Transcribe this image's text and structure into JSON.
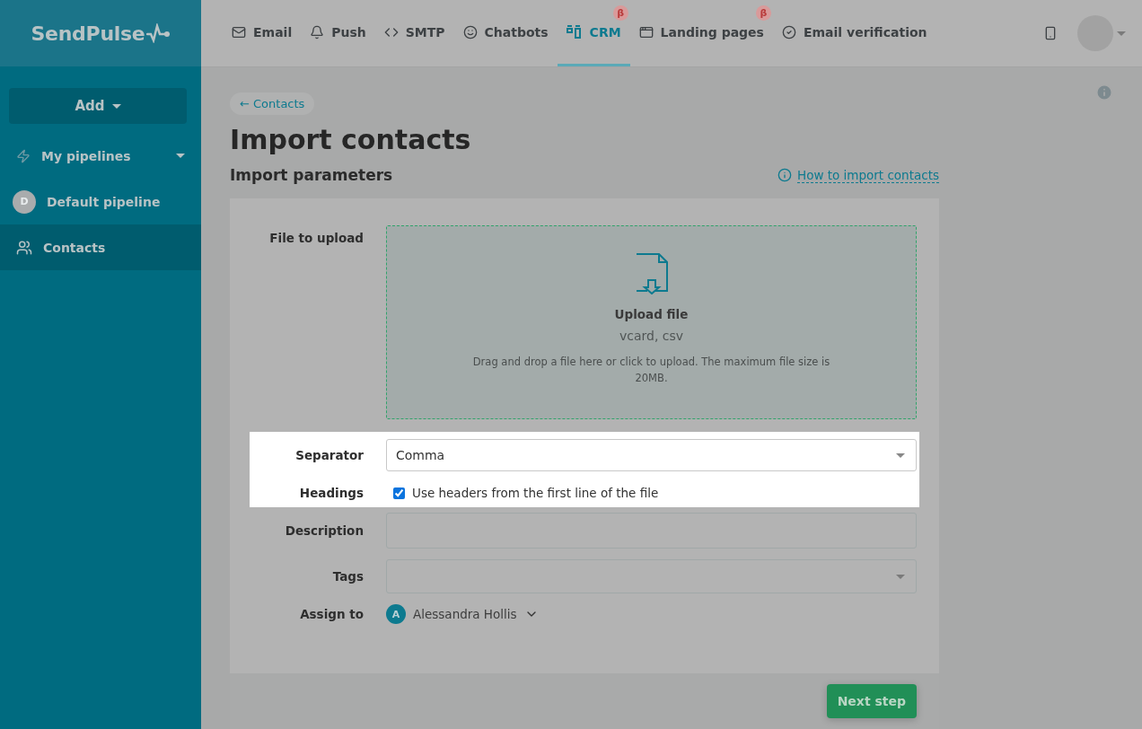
{
  "logo": "SendPulse",
  "nav": [
    {
      "label": "Email",
      "selected": false
    },
    {
      "label": "Push",
      "selected": false
    },
    {
      "label": "SMTP",
      "selected": false
    },
    {
      "label": "Chatbots",
      "selected": false
    },
    {
      "label": "CRM",
      "selected": true,
      "badge": "β"
    },
    {
      "label": "Landing pages",
      "selected": false,
      "badge": "β"
    },
    {
      "label": "Email verification",
      "selected": false
    }
  ],
  "sidebar": {
    "add_button": "Add",
    "items": [
      {
        "kind": "group",
        "label": "My pipelines",
        "selected": false
      },
      {
        "kind": "pipeline",
        "label": "Default pipeline",
        "initial": "D",
        "selected": false
      },
      {
        "kind": "contacts",
        "label": "Contacts",
        "selected": true
      }
    ]
  },
  "back_link": "← Contacts",
  "title": "Import contacts",
  "section_title": "Import parameters",
  "help_link": "How to import contacts",
  "form": {
    "rows": [
      {
        "kind": "upload",
        "label": "File to upload",
        "highlighted": false,
        "title": "Upload file",
        "formats": "vcard, csv",
        "hint": "Drag and drop a file here or click to upload. The maximum file size is 20MB."
      },
      {
        "kind": "select",
        "label": "Separator",
        "highlighted": true,
        "value": "Comma"
      },
      {
        "kind": "checkbox",
        "label": "Headings",
        "highlighted": true,
        "text": "Use headers from the first line of the file",
        "checked": true
      },
      {
        "kind": "input",
        "label": "Description",
        "highlighted": false
      },
      {
        "kind": "select",
        "label": "Tags",
        "highlighted": false
      },
      {
        "kind": "user",
        "label": "Assign to",
        "highlighted": false,
        "initial": "A",
        "value": "Alessandra Hollis"
      }
    ]
  },
  "next_button": "Next step"
}
